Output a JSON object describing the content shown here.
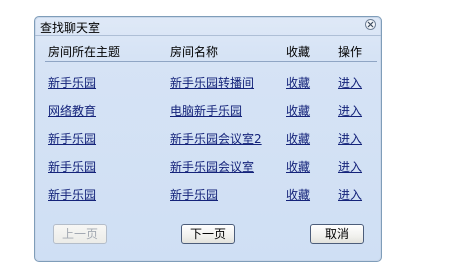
{
  "dialog": {
    "title": "查找聊天室"
  },
  "columns": {
    "topic": "房间所在主题",
    "name": "房间名称",
    "favorite": "收藏",
    "action": "操作"
  },
  "rows": [
    {
      "topic": "新手乐园",
      "name": "新手乐园转播间",
      "favorite": "收藏",
      "action": "进入"
    },
    {
      "topic": "网络教育",
      "name": "电脑新手乐园",
      "favorite": "收藏",
      "action": "进入"
    },
    {
      "topic": "新手乐园",
      "name": "新手乐园会议室2",
      "favorite": "收藏",
      "action": "进入"
    },
    {
      "topic": "新手乐园",
      "name": "新手乐园会议室",
      "favorite": "收藏",
      "action": "进入"
    },
    {
      "topic": "新手乐园",
      "name": "新手乐园",
      "favorite": "收藏",
      "action": "进入"
    }
  ],
  "buttons": {
    "prev": "上一页",
    "next": "下一页",
    "cancel": "取消"
  },
  "icons": {
    "close": "close-icon"
  },
  "colors": {
    "link": "#14237a",
    "dialog_border": "#7f9db9",
    "dialog_background": "#d6e3f5"
  }
}
